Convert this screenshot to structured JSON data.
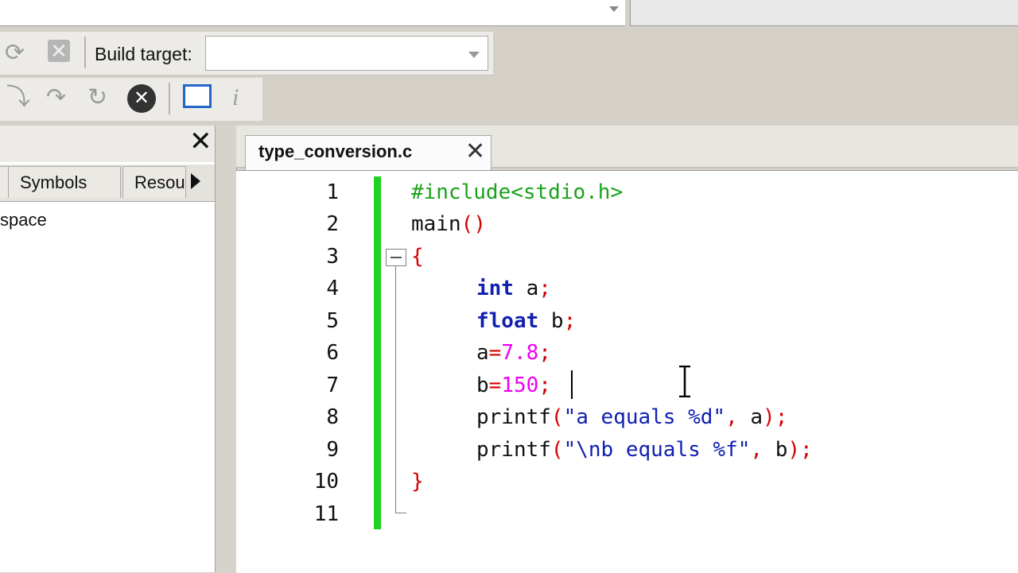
{
  "toolbar": {
    "build_target_label": "Build target:",
    "build_target_value": ""
  },
  "left_panel": {
    "tabs": [
      {
        "label": ""
      },
      {
        "label": "Symbols"
      },
      {
        "label": "Resou"
      }
    ],
    "tree_item": "space"
  },
  "editor": {
    "tab_title": "type_conversion.c",
    "line_numbers": [
      "1",
      "2",
      "3",
      "4",
      "5",
      "6",
      "7",
      "8",
      "9",
      "10",
      "11"
    ]
  },
  "code": {
    "l1": "#include<stdio.h>",
    "l2_fn": "main",
    "l2_paren": "()",
    "l3": "{",
    "l4_kw": "int",
    "l4_rest": " a",
    "l5_kw": "float",
    "l5_rest": " b",
    "l6_var": "a",
    "l6_num": "7.8",
    "l7_var": "b",
    "l7_num": "150",
    "l8_fn": "printf",
    "l8_str": "\"a equals %d\"",
    "l8_var": "a",
    "l9_fn": "printf",
    "l9_str": "\"\\nb equals %f\"",
    "l9_var": "b",
    "l10": "}",
    "semicolon": ";",
    "equals": "=",
    "open_paren": "(",
    "close_paren": ")",
    "comma": ", "
  },
  "colors": {
    "change_bar": "#1fd21f",
    "keyword": "#1020b0",
    "preprocessor": "#1aa21a",
    "operator": "#d40000",
    "number": "#f000f0"
  }
}
